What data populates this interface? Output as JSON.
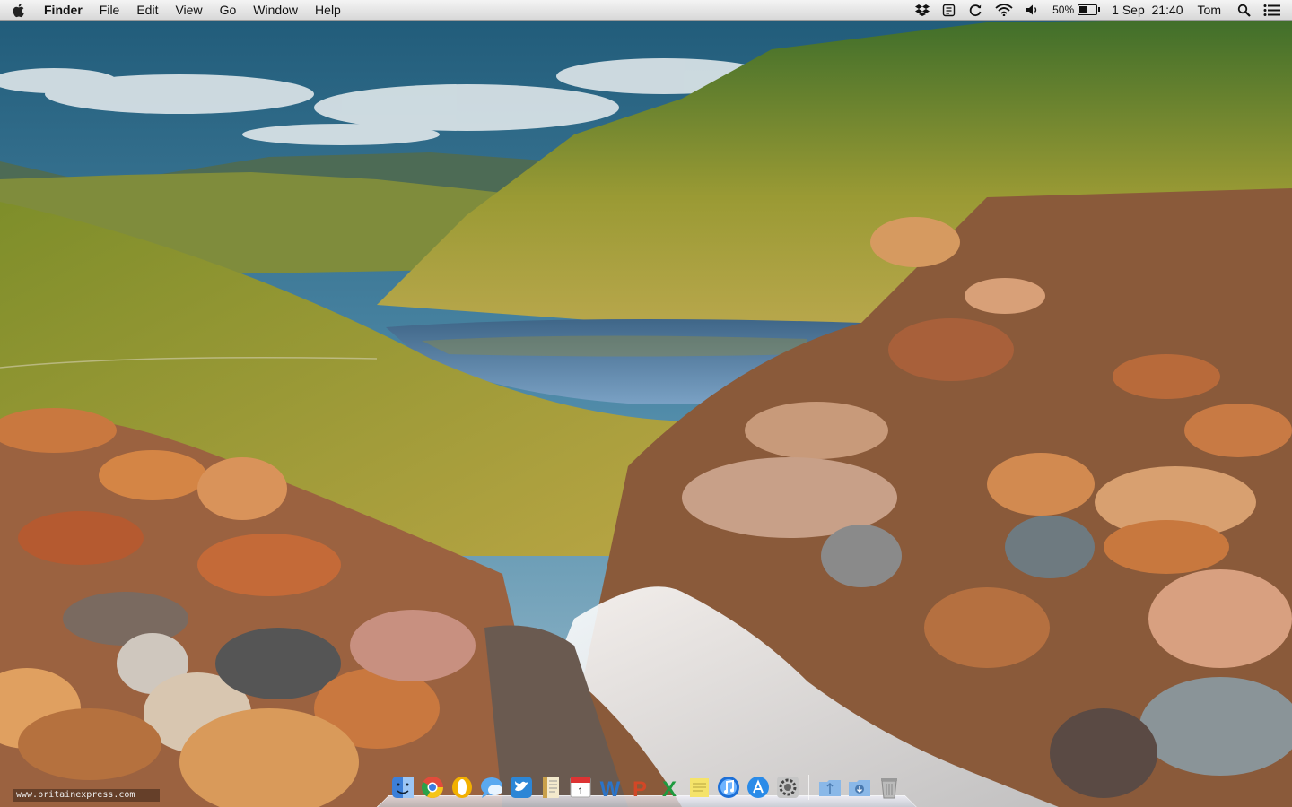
{
  "menubar": {
    "apple_icon": "apple-logo-icon",
    "app_name": "Finder",
    "menus": [
      "File",
      "Edit",
      "View",
      "Go",
      "Window",
      "Help"
    ],
    "status": {
      "battery_percent": "50%",
      "battery_level": 0.5,
      "datetime": "1 Sep  21:40",
      "user": "Tom",
      "icons": [
        "dropbox-icon",
        "evernote-icon",
        "sync-icon",
        "wifi-icon",
        "volume-icon",
        "battery-icon",
        "spotlight-search-icon",
        "notification-list-icon"
      ]
    }
  },
  "desktop": {
    "wallpaper": "mountain valley with lake, rocks and stream",
    "watermark": "www.britainexpress.com"
  },
  "dock": {
    "apps": [
      {
        "name": "Finder",
        "icon": "finder-icon",
        "color": "#3c7fd8"
      },
      {
        "name": "Google Chrome",
        "icon": "chrome-icon",
        "color": "#e24b3b"
      },
      {
        "name": "Opera",
        "icon": "opera-icon",
        "color": "#f2b000"
      },
      {
        "name": "Messages",
        "icon": "messages-icon",
        "color": "#5aa9f0"
      },
      {
        "name": "Tweetbot",
        "icon": "twitter-icon",
        "color": "#2c86d6"
      },
      {
        "name": "Pages",
        "icon": "pages-icon",
        "color": "#c9a04b"
      },
      {
        "name": "Calendar",
        "icon": "calendar-icon",
        "color": "#d33"
      },
      {
        "name": "Word",
        "icon": "word-icon",
        "color": "#2b74c9"
      },
      {
        "name": "PowerPoint",
        "icon": "powerpoint-icon",
        "color": "#d24726"
      },
      {
        "name": "Excel",
        "icon": "excel-icon",
        "color": "#1e9a3e"
      },
      {
        "name": "Stickies",
        "icon": "notes-icon",
        "color": "#f5e36a"
      },
      {
        "name": "iTunes",
        "icon": "itunes-icon",
        "color": "#1d6fd6"
      },
      {
        "name": "App Store",
        "icon": "app-store-icon",
        "color": "#2a8be8"
      },
      {
        "name": "System Preferences",
        "icon": "system-preferences-icon",
        "color": "#777"
      }
    ],
    "stacks": [
      {
        "name": "Applications",
        "icon": "applications-folder-icon",
        "color": "#8ab8e8"
      },
      {
        "name": "Downloads",
        "icon": "downloads-folder-icon",
        "color": "#8ab8e8"
      },
      {
        "name": "Trash",
        "icon": "trash-icon",
        "color": "#bbb"
      }
    ]
  },
  "colors": {
    "menubar_bg": "#e6e6e6",
    "sky": "#5c90b4",
    "lake": "#5d86b0",
    "grass": "#a7a23a",
    "rock": "#b86b3a"
  }
}
